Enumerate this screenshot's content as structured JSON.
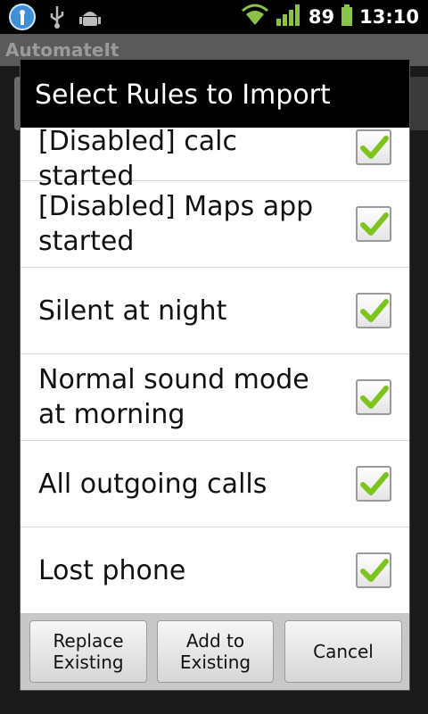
{
  "status_bar": {
    "battery_level": "89",
    "time": "13:10",
    "icons": [
      "tower-icon",
      "usb-icon",
      "android-debug-icon",
      "wifi-icon",
      "signal-icon",
      "battery-icon"
    ]
  },
  "background_app": {
    "title": "AutomateIt"
  },
  "dialog": {
    "title": "Select Rules to Import",
    "rules": [
      {
        "label": "[Disabled] calc started",
        "checked": true
      },
      {
        "label": "[Disabled] Maps app started",
        "checked": true
      },
      {
        "label": "Silent at night",
        "checked": true
      },
      {
        "label": "Normal sound mode at morning",
        "checked": true
      },
      {
        "label": "All outgoing calls",
        "checked": true
      },
      {
        "label": "Lost phone",
        "checked": true
      }
    ],
    "buttons": {
      "replace": "Replace Existing",
      "add": "Add to Existing",
      "cancel": "Cancel"
    }
  },
  "colors": {
    "check_green": "#7ec41f",
    "status_green": "#8bc34a"
  }
}
